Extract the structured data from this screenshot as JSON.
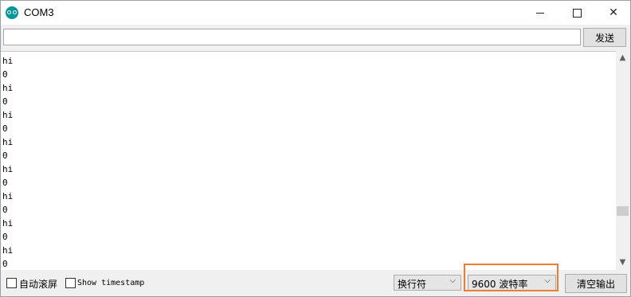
{
  "window": {
    "title": "COM3"
  },
  "send": {
    "input_value": "",
    "button_label": "发送"
  },
  "output": {
    "lines": [
      "hi",
      "0",
      "hi",
      "0",
      "hi",
      "0",
      "hi",
      "0",
      "hi",
      "0",
      "hi",
      "0",
      "hi",
      "0",
      "hi",
      "0"
    ]
  },
  "bottom": {
    "autoscroll_label": "自动滚屏",
    "timestamp_label": "Show timestamp",
    "line_ending": "换行符",
    "baud_rate": "9600 波特率",
    "clear_label": "清空输出"
  },
  "colors": {
    "highlight": "#ed7d31",
    "icon": "#00979c"
  }
}
